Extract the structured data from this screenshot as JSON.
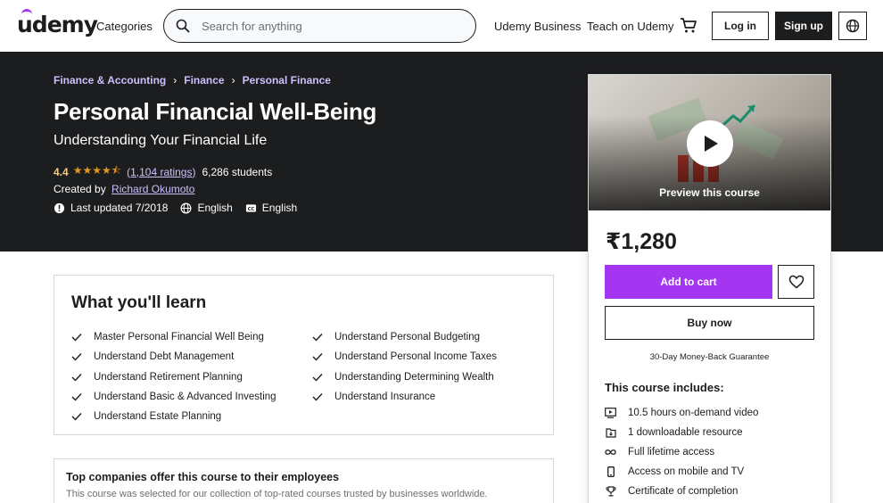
{
  "header": {
    "logo": "udemy",
    "categories": "Categories",
    "search_placeholder": "Search for anything",
    "business": "Udemy Business",
    "teach": "Teach on Udemy",
    "login": "Log in",
    "signup": "Sign up"
  },
  "course": {
    "breadcrumbs": [
      "Finance & Accounting",
      "Finance",
      "Personal Finance"
    ],
    "title": "Personal Financial Well-Being",
    "subtitle": "Understanding Your Financial Life",
    "rating": "4.4",
    "stars": "★★★★⯪",
    "ratings_count": "(1,104 ratings)",
    "students": "6,286 students",
    "created_by_label": "Created by",
    "instructor": "Richard Okumoto",
    "last_updated": "Last updated 7/2018",
    "language": "English",
    "captions": "English"
  },
  "sidebar": {
    "preview_label": "Preview this course",
    "price": "₹1,280",
    "add_to_cart": "Add to cart",
    "buy_now": "Buy now",
    "guarantee": "30-Day Money-Back Guarantee",
    "includes_title": "This course includes:",
    "includes": [
      {
        "icon": "video-icon",
        "text": "10.5 hours on-demand video"
      },
      {
        "icon": "file-icon",
        "text": "1 downloadable resource"
      },
      {
        "icon": "infinity-icon",
        "text": "Full lifetime access"
      },
      {
        "icon": "mobile-icon",
        "text": "Access on mobile and TV"
      },
      {
        "icon": "trophy-icon",
        "text": "Certificate of completion"
      }
    ]
  },
  "learn": {
    "title": "What you'll learn",
    "left": [
      "Master Personal Financial Well Being",
      "Understand Debt Management",
      "Understand Retirement Planning",
      "Understand Basic & Advanced Investing",
      "Understand Estate Planning"
    ],
    "right": [
      "Understand Personal Budgeting",
      "Understand Personal Income Taxes",
      "Understanding Determining Wealth",
      "Understand Insurance"
    ]
  },
  "companies": {
    "title": "Top companies offer this course to their employees",
    "text": "This course was selected for our collection of top-rated courses trusted by businesses worldwide."
  },
  "colors": {
    "brand_purple": "#a435f0",
    "dark_band": "#1c1d1f",
    "link_purple": "#cec0fc",
    "star": "#e59819",
    "rating_text": "#f3ca8c"
  }
}
